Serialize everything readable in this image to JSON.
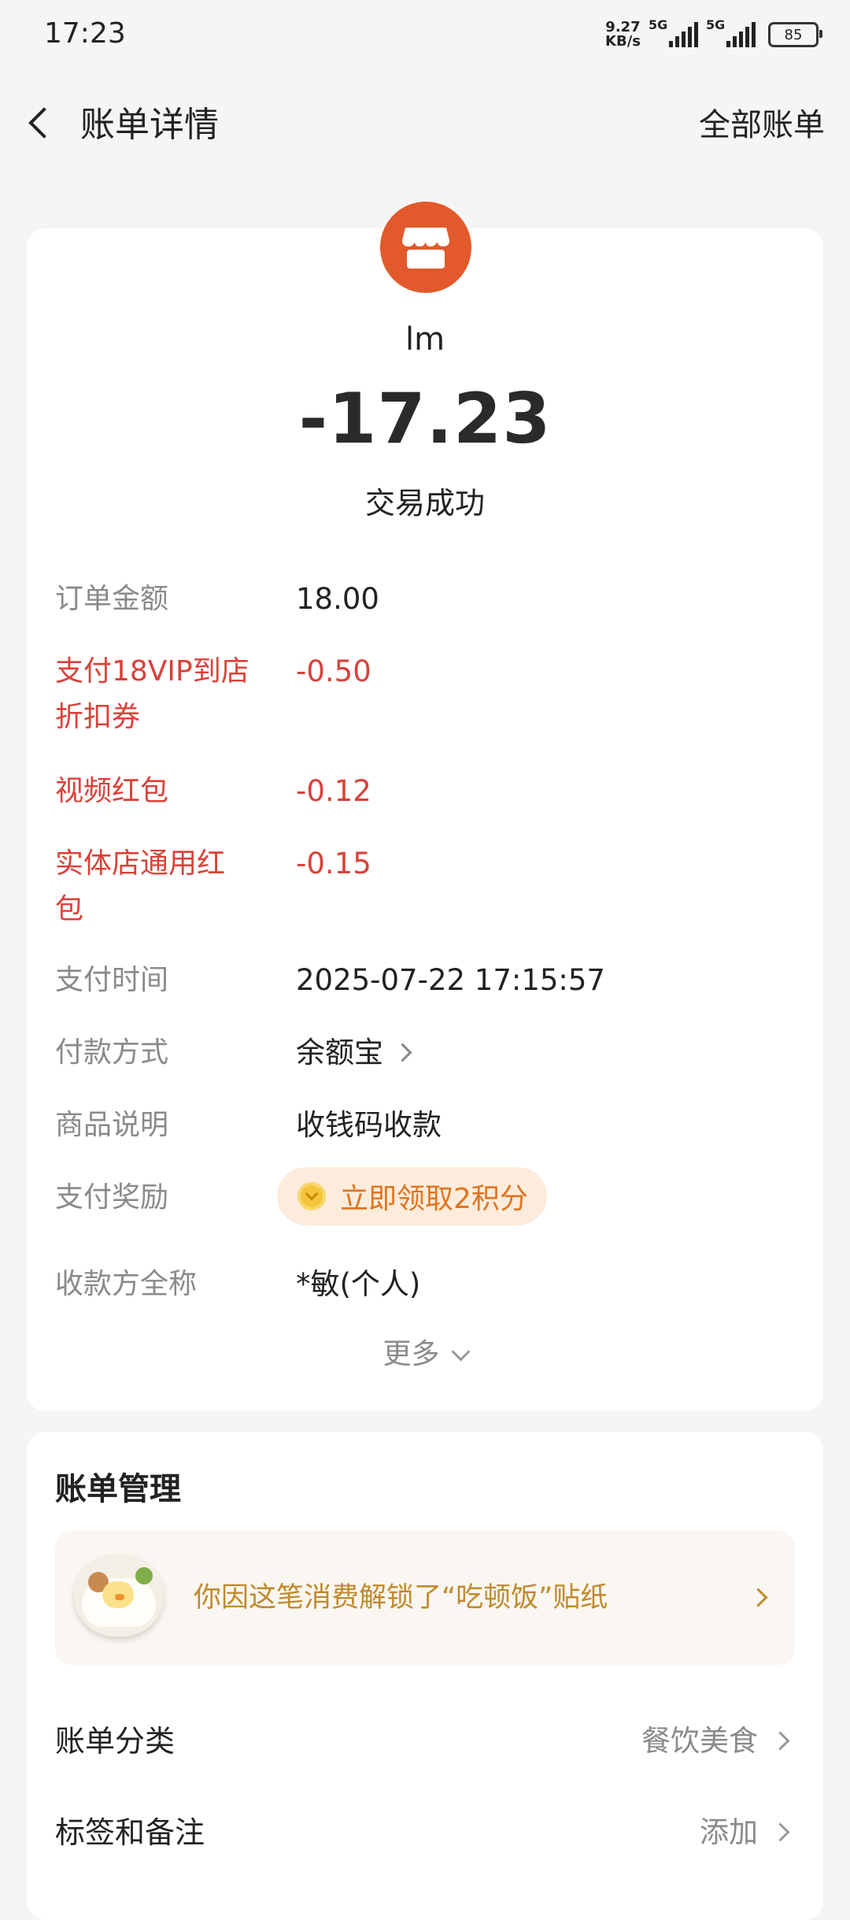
{
  "status_bar": {
    "time": "17:23",
    "net_speed_value": "9.27",
    "net_speed_unit": "KB/s",
    "sim1": "5G",
    "sim2": "5G",
    "battery": "85"
  },
  "nav": {
    "title": "账单详情",
    "all_bills": "全部账单"
  },
  "transaction": {
    "merchant_icon": "store-icon",
    "merchant_name": "lm",
    "amount": "-17.23",
    "status": "交易成功"
  },
  "details": {
    "order_amount_label": "订单金额",
    "order_amount_value": "18.00",
    "coupon_label_line1": "支付18VIP到店",
    "coupon_label_line2": "折扣券",
    "coupon_value": "-0.50",
    "video_redpacket_label": "视频红包",
    "video_redpacket_value": "-0.12",
    "store_redpacket_label_line1": "实体店通用红",
    "store_redpacket_label_line2": "包",
    "store_redpacket_value": "-0.15",
    "pay_time_label": "支付时间",
    "pay_time_value": "2025-07-22 17:15:57",
    "pay_method_label": "付款方式",
    "pay_method_value": "余额宝",
    "goods_desc_label": "商品说明",
    "goods_desc_value": "收钱码收款",
    "reward_label": "支付奖励",
    "reward_button": "立即领取2积分",
    "payee_label": "收款方全称",
    "payee_value": "*敏(个人)",
    "more": "更多"
  },
  "bill_manage": {
    "title": "账单管理",
    "sticker_text": "你因这笔消费解锁了“吃顿饭”贴纸",
    "category_label": "账单分类",
    "category_value": "餐饮美食",
    "tags_label": "标签和备注",
    "tags_value": "添加"
  },
  "colors": {
    "accent_red": "#d9423a",
    "merchant_icon_bg": "#e2592b",
    "reward_bg": "#fdecdc",
    "reward_text": "#e07520",
    "sticker_text": "#c08a2c"
  }
}
